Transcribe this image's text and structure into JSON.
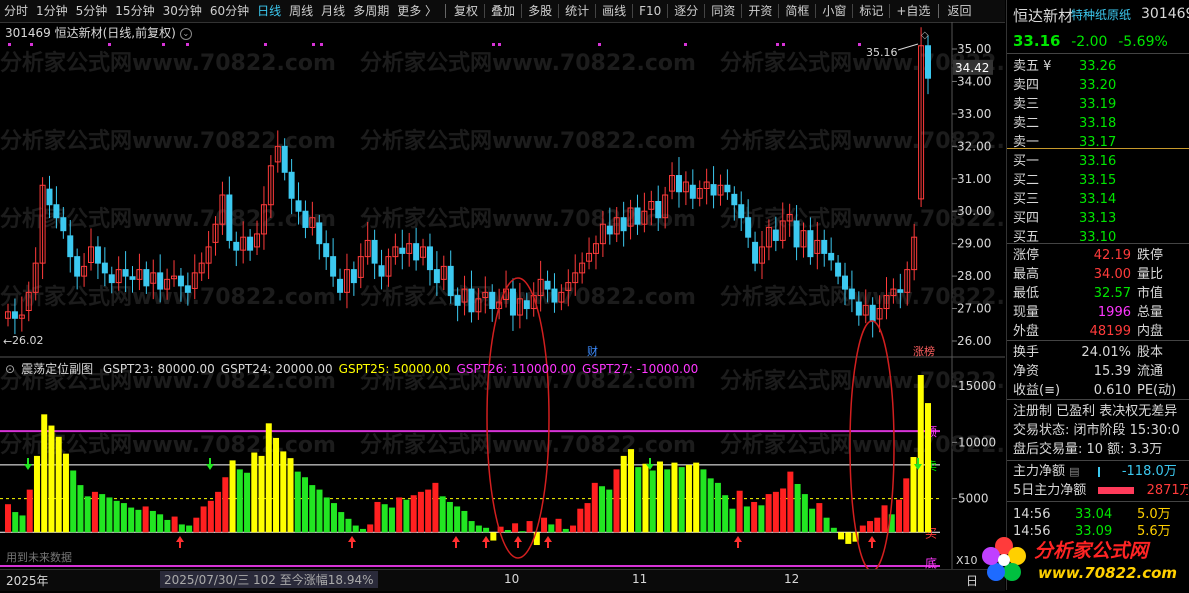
{
  "toolbar": {
    "items": [
      "分时",
      "1分钟",
      "5分钟",
      "15分钟",
      "30分钟",
      "60分钟",
      "日线",
      "周线",
      "月线",
      "多周期",
      "更多 〉",
      "复权",
      "叠加",
      "多股",
      "统计",
      "画线",
      "F10",
      "逐分",
      "同资",
      "开资",
      "简框",
      "小窗",
      "标记",
      "+自选",
      "返回"
    ],
    "active": "日线"
  },
  "chart_title": "301469 恒达新材(日线,前复权)",
  "watermark": "分析家公式网www.70822.com",
  "price_axis": {
    "ticks": [
      "35.00",
      "34.00",
      "33.00",
      "32.00",
      "31.00",
      "30.00",
      "29.00",
      "28.00",
      "27.00",
      "26.00"
    ],
    "current": "34.42"
  },
  "annotations": {
    "high": "35.16",
    "low": "26.02",
    "cai": "财",
    "zhangbang": "涨榜"
  },
  "sub_indicator": {
    "name": "震荡定位副图",
    "params": [
      {
        "text": "GSPT23: 80000.00",
        "color": "#d8d8d8"
      },
      {
        "text": "GSPT24: 20000.00",
        "color": "#d8d8d8"
      },
      {
        "text": "GSPT25: 50000.00",
        "color": "#ffff00"
      },
      {
        "text": "GSPT26: 110000.00",
        "color": "#ff37ff"
      },
      {
        "text": "GSPT27: -10000.00",
        "color": "#ff37ff"
      }
    ],
    "axis_ticks": [
      "15000",
      "10000",
      "5000"
    ],
    "axis_unit": "X10",
    "labels": {
      "top": "顶",
      "sell": "卖",
      "buy": "买",
      "bottom": "底"
    },
    "note": "用到未来数据"
  },
  "bottom": {
    "year": "2025年",
    "info": "2025/07/30/三 102 至今涨幅18.94%",
    "months": [
      "10",
      "11",
      "12"
    ],
    "right_char": "日"
  },
  "quote": {
    "name": "恒达新材",
    "concept": "特种纸原纸",
    "code": "301469",
    "price": "33.16",
    "change": "-2.00",
    "pct": "-5.69%",
    "asks": [
      {
        "label": "卖五 ¥",
        "price": "33.26"
      },
      {
        "label": "卖四",
        "price": "33.20"
      },
      {
        "label": "卖三",
        "price": "33.19"
      },
      {
        "label": "卖二",
        "price": "33.18"
      },
      {
        "label": "卖一",
        "price": "33.17"
      }
    ],
    "bids": [
      {
        "label": "买一",
        "price": "33.16"
      },
      {
        "label": "买二",
        "price": "33.15"
      },
      {
        "label": "买三",
        "price": "33.14"
      },
      {
        "label": "买四",
        "price": "33.13"
      },
      {
        "label": "买五",
        "price": "33.10"
      }
    ],
    "stats": [
      {
        "l1": "涨停",
        "v1": "42.19",
        "c1": "#ff3b3b",
        "l2": "跌停"
      },
      {
        "l1": "最高",
        "v1": "34.00",
        "c1": "#ff3b3b",
        "l2": "量比"
      },
      {
        "l1": "最低",
        "v1": "32.57",
        "c1": "#00e600",
        "l2": "市值"
      },
      {
        "l1": "现量",
        "v1": "1996",
        "c1": "#ff37ff",
        "l2": "总量"
      },
      {
        "l1": "外盘",
        "v1": "48199",
        "c1": "#ff3b3b",
        "l2": "内盘"
      },
      {
        "l1": "换手",
        "v1": "24.01%",
        "c1": "#d8d8d8",
        "l2": "股本"
      },
      {
        "l1": "净资",
        "v1": "15.39",
        "c1": "#d8d8d8",
        "l2": "流通"
      },
      {
        "l1": "收益(≡)",
        "v1": "0.610",
        "c1": "#d8d8d8",
        "l2": "PE(动)"
      }
    ],
    "tags": "注册制 已盈利 表决权无差异",
    "trade_state": "交易状态: 闭市阶段 15:30:0",
    "after_hours": "盘后交易量: 10  额: 3.3万",
    "main_flow": {
      "label": "主力净额",
      "value": "-118.0万"
    },
    "main_flow_5d": {
      "label": "5日主力净额",
      "value": "2871万"
    },
    "ticks": [
      {
        "time": "14:56",
        "price": "33.04",
        "vol": "5.0万"
      },
      {
        "time": "14:56",
        "price": "33.09",
        "vol": "5.6万"
      }
    ]
  },
  "logo": {
    "text": "分析家公式网",
    "url": "www.70822.com"
  },
  "colors": {
    "up": "#ff3b3b",
    "down": "#3cc9f0",
    "purple": "#d633d6",
    "yellow": "#ffff00",
    "green": "#00e600"
  }
}
